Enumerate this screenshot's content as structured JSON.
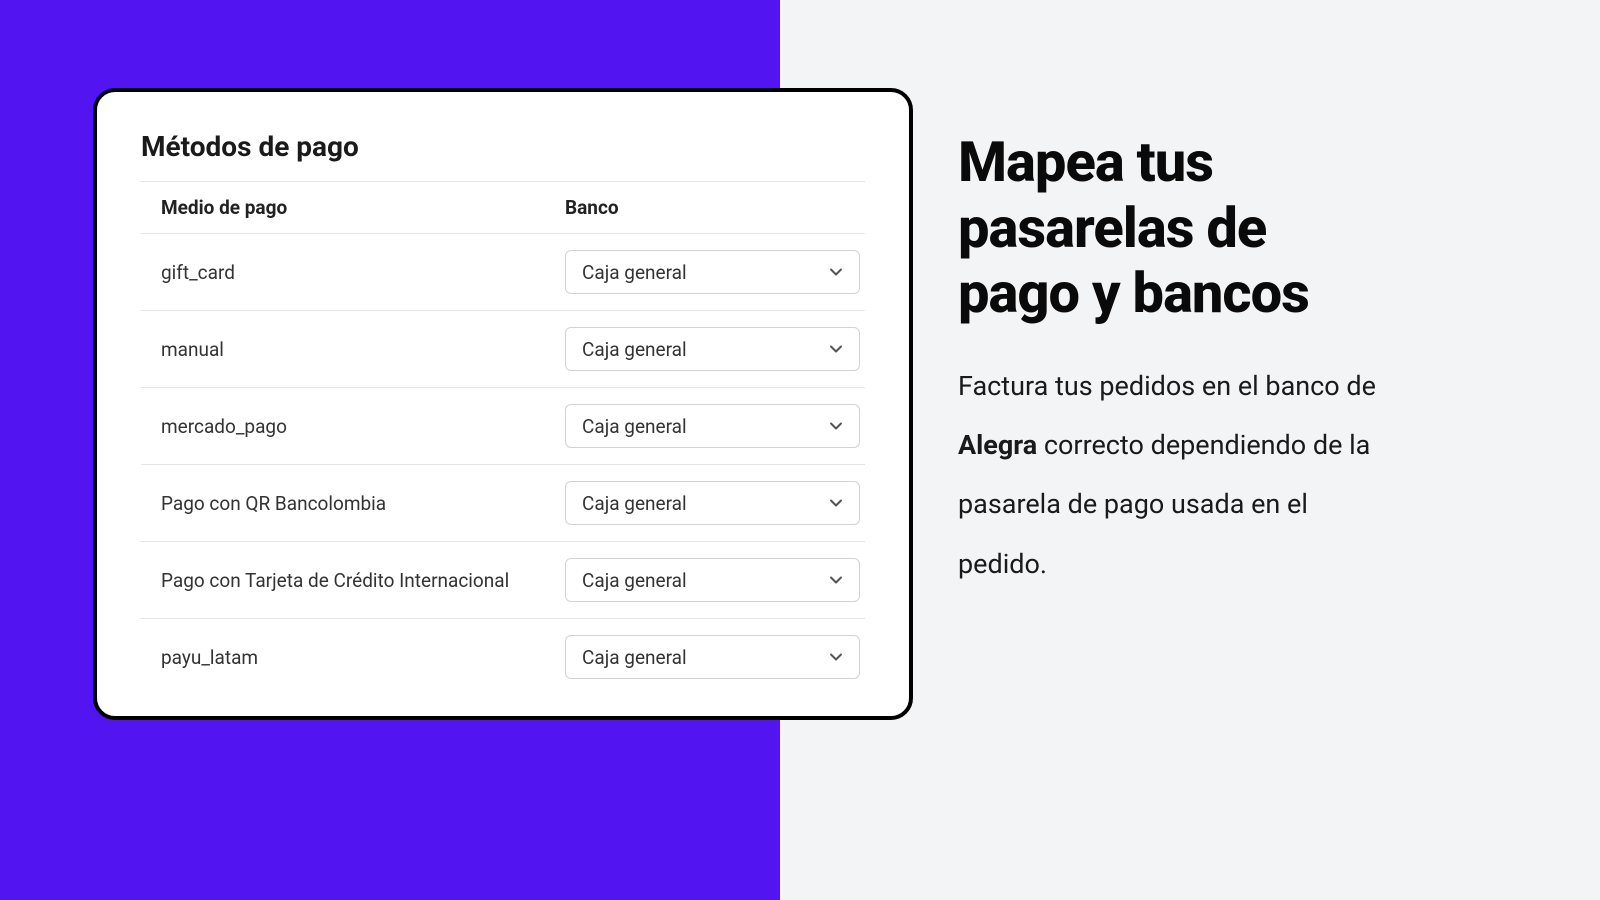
{
  "card": {
    "title": "Métodos de pago",
    "columns": {
      "method": "Medio de pago",
      "bank": "Banco"
    },
    "rows": [
      {
        "method": "gift_card",
        "bank": "Caja general"
      },
      {
        "method": "manual",
        "bank": "Caja general"
      },
      {
        "method": "mercado_pago",
        "bank": "Caja general"
      },
      {
        "method": "Pago con QR Bancolombia",
        "bank": "Caja general"
      },
      {
        "method": "Pago con Tarjeta de Crédito Internacional",
        "bank": "Caja general"
      },
      {
        "method": "payu_latam",
        "bank": "Caja general"
      }
    ]
  },
  "right": {
    "headline": "Mapea tus pasarelas de pago y bancos",
    "body_pre": "Factura tus pedidos en el banco de ",
    "body_bold": "Alegra",
    "body_post": " correcto dependiendo de la pasarela de pago usada en el pedido."
  }
}
